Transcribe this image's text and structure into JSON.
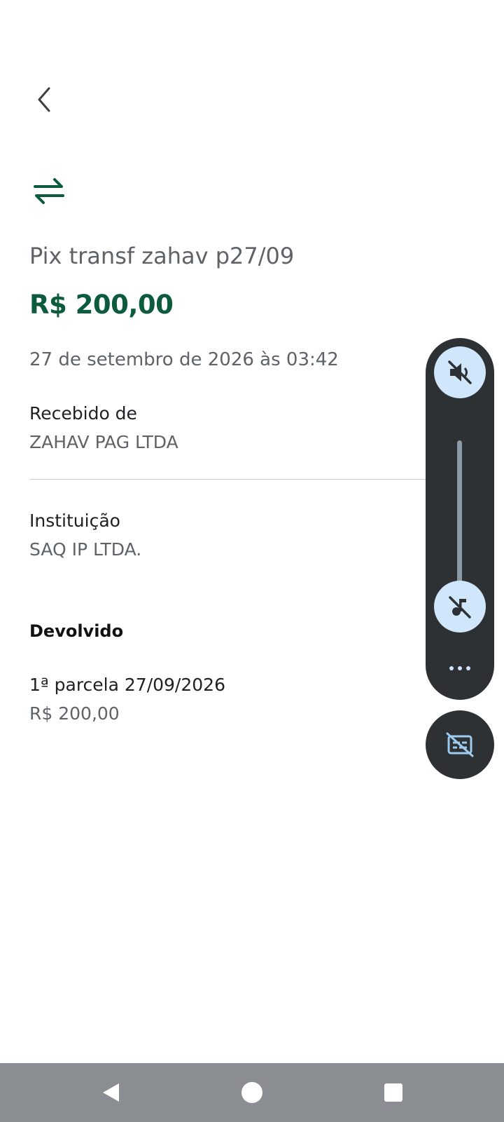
{
  "header": {
    "back_icon": "chevron-left-icon"
  },
  "transaction": {
    "type_icon": "transfer-arrows-icon",
    "title": "Pix transf zahav p27/09",
    "amount": "R$ 200,00",
    "datetime": "27 de setembro de 2026 às 03:42",
    "accent_color": "#0b5b3c"
  },
  "details": {
    "received_from_label": "Recebido de",
    "received_from_value": "ZAHAV PAG LTDA",
    "institution_label": "Instituição",
    "institution_value": "SAQ IP LTDA."
  },
  "refund": {
    "section_title": "Devolvido",
    "installment_label": "1ª parcela 27/09/2026",
    "installment_value": "R$ 200,00"
  },
  "volume_panel": {
    "top_icon": "volume-muted-icon",
    "bottom_icon": "music-note-off-icon",
    "more_icon": "more-horizontal-icon",
    "captions_icon": "captions-off-icon",
    "level": 0
  },
  "nav_bar": {
    "back_icon": "nav-back-icon",
    "home_icon": "nav-home-icon",
    "recents_icon": "nav-recents-icon"
  }
}
